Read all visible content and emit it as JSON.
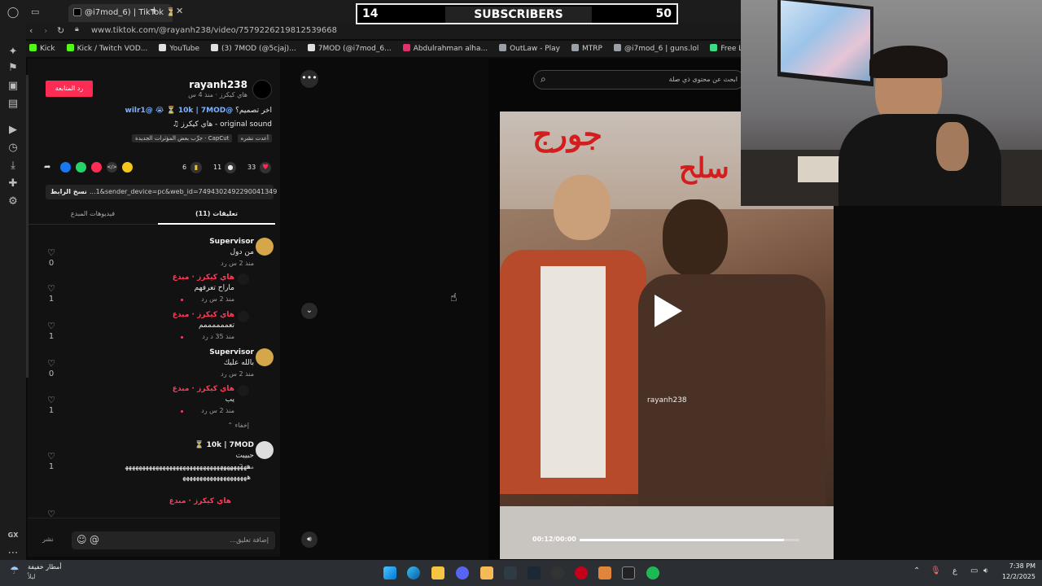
{
  "browser": {
    "tab_title": "@i7mod_6) | TikTok ⏳(46)",
    "url": "www.tiktok.com/@rayanh238/video/7579226219812539668",
    "bookmarks": [
      {
        "label": "Kick",
        "color": "#53fc18"
      },
      {
        "label": "Kick / Twitch VOD...",
        "color": "#53fc18"
      },
      {
        "label": "YouTube",
        "color": "#e0e0e0"
      },
      {
        "label": "(3) 7MOD (@5cjaj)...",
        "color": "#e0e0e0"
      },
      {
        "label": "7MOD (@i7mod_6...",
        "color": "#e0e0e0"
      },
      {
        "label": "Abdulrahman alha...",
        "color": "#e1306c"
      },
      {
        "label": "OutLaw - Play",
        "color": "#9aa0a6"
      },
      {
        "label": "MTRP",
        "color": "#9aa0a6"
      },
      {
        "label": "@i7mod_6 | guns.lol",
        "color": "#9aa0a6"
      },
      {
        "label": "Free Live Streamin...",
        "color": "#3ddc84"
      },
      {
        "label": "KickE",
        "color": "#f5e400"
      }
    ],
    "sidebar_letters": "GX"
  },
  "overlay": {
    "left": "14",
    "label": "SUBSCRIBERS",
    "right": "50"
  },
  "post": {
    "username": "rayanh238",
    "subtitle": "هاي كيكرز · منذ 4 س",
    "follow_label": "رد المتابعة",
    "caption_prefix": "اخر تصميم؟",
    "caption_mention": "@wilr1@ 😭 ⏳ 10k | 7MOD",
    "sound": "original sound - هاي كيكرز",
    "capcut_label": "CapCut · جرِّب بعض المؤثرات الجديدة",
    "reposted_label": "أعدت نشره",
    "likes": "33",
    "comments_count": "11",
    "saves": "6",
    "link_text": "...1&sender_device=pc&web_id=7494302492290041349",
    "copy_link": "نسخ الرابط",
    "tab_comments": "تعليقات (11)",
    "tab_creator_videos": "فيديوهات المبدع"
  },
  "comments": [
    {
      "name": "Supervisor",
      "text": "من دول",
      "meta": "منذ 2 س    رد",
      "likes": "0"
    },
    {
      "name": "هاي كيكرز · مبدع",
      "text": "ماراح تعرفهم",
      "meta": "منذ 2 س    رد",
      "likes": "1"
    },
    {
      "name": "هاي كيكرز · مبدع",
      "text": "تعممممممم",
      "meta": "منذ 35 د    رد",
      "likes": "1"
    },
    {
      "name": "Supervisor",
      "text": "بالله عليك",
      "meta": "منذ 2 س    رد",
      "likes": "0"
    },
    {
      "name": "هاي كيكرز · مبدع",
      "text": "يب",
      "meta": "منذ 2 س    رد",
      "likes": "1"
    },
    {
      "name": "10k | 7MOD ⏳",
      "text": "حبيبت",
      "meta": "منذ 2 س    رد",
      "likes": "1"
    }
  ],
  "hide_label": "إخفاء ⌃",
  "long_text": "ﻫﻬﻬﻬﻬﻬﻬﻬﻬﻬﻬﻬﻬﻬﻬﻬﻬﻬﻬﻬﻬﻬﻬﻬﻬﻬﻬﻬﻬﻬﻬﻬﻬﻬﻬﻬﻬ",
  "long_text_2": "ﻫﻬﻬﻬﻬﻬﻬﻬﻬﻬﻬﻬﻬﻬﻬﻬﻬﻬﻬﻬ",
  "last_author": "هاي كيكرز · مبدع",
  "comment_box": {
    "placeholder": "إضافة تعليق...",
    "post_label": "نشر"
  },
  "video": {
    "search_placeholder": "ابحث عن محتوى ذي صلة",
    "overlay_text": "جورج",
    "overlay_text_2": "سلح",
    "watermark": "rayanh238",
    "time": "00:12/00:00",
    "progress": 0.93
  },
  "taskbar": {
    "weather": "أمطار خفيفة",
    "weather_sub": "ليلاً",
    "time": "7:38 PM",
    "date": "12/2/2025",
    "lang": "ع"
  }
}
